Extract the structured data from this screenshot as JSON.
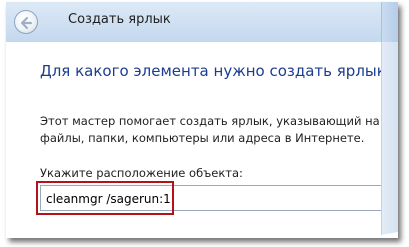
{
  "window": {
    "title": "Создать ярлык"
  },
  "content": {
    "heading": "Для какого элемента нужно создать ярлык?",
    "description_line1": "Этот мастер помогает создать ярлык, указывающий на локал",
    "description_line2": "файлы, папки, компьютеры или адреса в Интернете.",
    "location_label": "Укажите расположение объекта:",
    "location_value": "cleanmgr /sagerun:1"
  },
  "icons": {
    "back": "back-arrow-icon"
  },
  "colors": {
    "heading": "#1b3d8f",
    "highlight": "#b5111b",
    "titlebar": "#cfe0f2"
  }
}
